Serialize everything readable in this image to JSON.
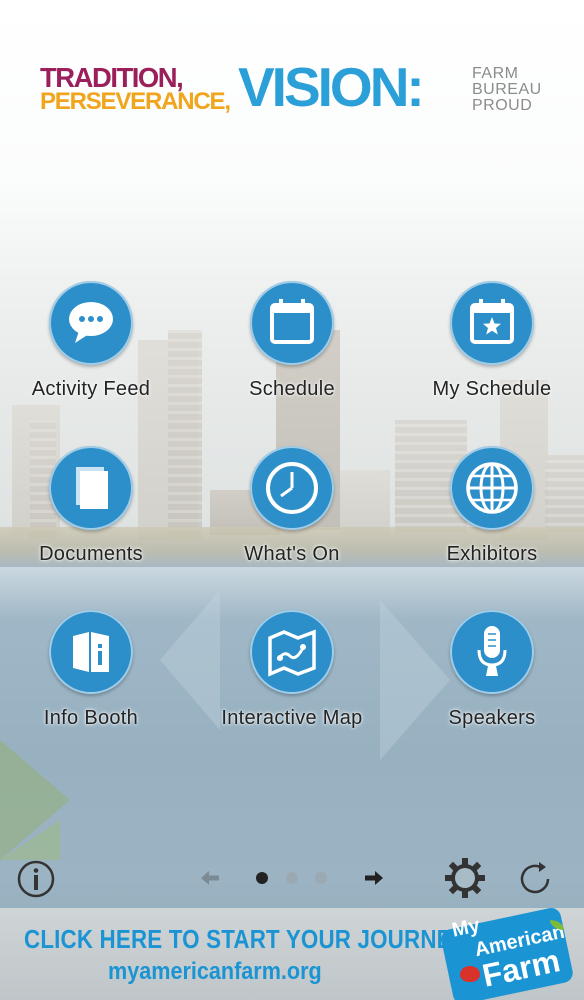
{
  "header": {
    "logo_line1": "TRADITION,",
    "logo_line2": "PERSEVERANCE,",
    "logo_line3": "VISION:",
    "logo_side": [
      "FARM",
      "BUREAU",
      "PROUD"
    ]
  },
  "grid": [
    {
      "label": "Activity Feed",
      "icon": "speech-bubble-icon"
    },
    {
      "label": "Schedule",
      "icon": "calendar-icon"
    },
    {
      "label": "My Schedule",
      "icon": "calendar-star-icon"
    },
    {
      "label": "Documents",
      "icon": "document-icon"
    },
    {
      "label": "What's On",
      "icon": "clock-icon"
    },
    {
      "label": "Exhibitors",
      "icon": "globe-icon"
    },
    {
      "label": "Info Booth",
      "icon": "info-booth-icon"
    },
    {
      "label": "Interactive Map",
      "icon": "map-icon"
    },
    {
      "label": "Speakers",
      "icon": "microphone-icon"
    }
  ],
  "toolbar": {
    "info_icon": "info-icon",
    "prev_icon": "arrow-left-icon",
    "next_icon": "arrow-right-icon",
    "settings_icon": "gear-icon",
    "refresh_icon": "refresh-icon",
    "page_count": 3,
    "current_page": 1
  },
  "banner": {
    "cta": "CLICK HERE TO START YOUR JOURNEY",
    "url": "myamericanfarm.org",
    "brand_line1": "My",
    "brand_line2": "American",
    "brand_line3": "Farm"
  },
  "colors": {
    "accent": "#2d8fc9",
    "banner_text": "#1b94d3",
    "logo_magenta": "#9b1f5b",
    "logo_orange": "#f0a51c",
    "logo_blue": "#2b9fd8"
  }
}
